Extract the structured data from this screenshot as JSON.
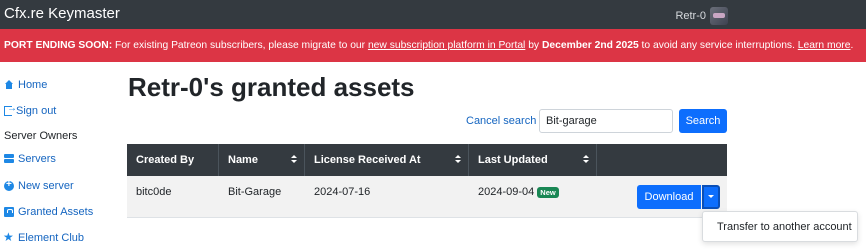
{
  "navbar": {
    "brand": "Cfx.re Keymaster",
    "username": "Retr-0",
    "avatar_icon": "user-avatar"
  },
  "banner": {
    "lead": "PORT ENDING SOON:",
    "text1": " For existing Patreon subscribers, please migrate to our ",
    "link1": "new subscription platform in Portal",
    "text2": " by ",
    "date": "December 2nd 2025",
    "text3": " to avoid any service interruptions. ",
    "link2": "Learn more",
    "text4": ".",
    "color": "#dc3545"
  },
  "sidebar": {
    "home": "Home",
    "signout": "Sign out",
    "heading": "Server Owners",
    "servers": "Servers",
    "new_server": "New server",
    "granted_assets": "Granted Assets",
    "element_club": "Element Club"
  },
  "main": {
    "title": "Retr-0's granted assets",
    "cancel_search": "Cancel search",
    "search_value": "Bit-garage",
    "search_button": "Search"
  },
  "table": {
    "headers": {
      "created_by": "Created By",
      "name": "Name",
      "license_received": "License Received At",
      "last_updated": "Last Updated"
    },
    "rows": [
      {
        "created_by": "bitc0de",
        "name": "Bit-Garage",
        "license_received": "2024-07-16",
        "last_updated": "2024-09-04",
        "badge": "New",
        "download": "Download"
      }
    ]
  },
  "dropdown": {
    "transfer": "Transfer to another account"
  },
  "colors": {
    "primary": "#0d6efd",
    "dark": "#343a40",
    "success": "#198754"
  }
}
